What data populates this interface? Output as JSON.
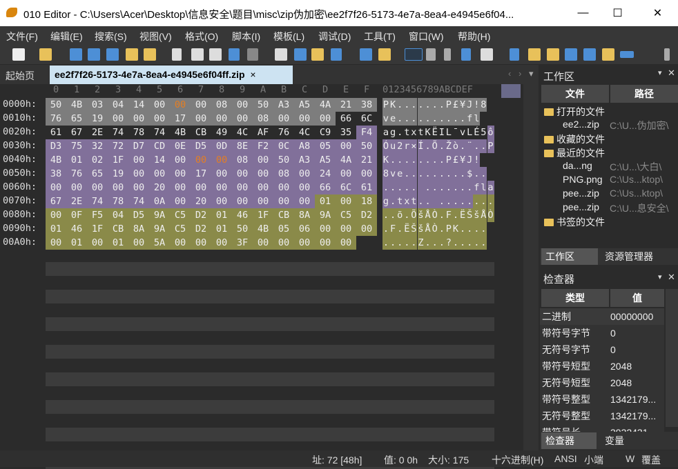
{
  "window": {
    "title": "010 Editor - C:\\Users\\Acer\\Desktop\\信息安全\\题目\\misc\\zip伪加密\\ee2f7f26-5173-4e7a-8ea4-e4945e6f04...",
    "minimize": "—",
    "maximize": "☐",
    "close": "✕"
  },
  "menu": [
    "文件(F)",
    "编辑(E)",
    "搜索(S)",
    "视图(V)",
    "格式(O)",
    "脚本(I)",
    "模板(L)",
    "调试(D)",
    "工具(T)",
    "窗口(W)",
    "帮助(H)"
  ],
  "tabs": {
    "start": "起始页",
    "file": "ee2f7f26-5173-4e7a-8ea4-e4945e6f04ff.zip",
    "close": "×"
  },
  "hex": {
    "col_headers": [
      "0",
      "1",
      "2",
      "3",
      "4",
      "5",
      "6",
      "7",
      "8",
      "9",
      "A",
      "B",
      "C",
      "D",
      "E",
      "F"
    ],
    "ascii_header": "0123456789ABCDEF",
    "rows": [
      {
        "offset": "0000h:",
        "bytes": [
          "50",
          "4B",
          "03",
          "04",
          "14",
          "00",
          "00",
          "00",
          "08",
          "00",
          "50",
          "A3",
          "A5",
          "4A",
          "21",
          "38"
        ],
        "ascii": "PK.......P£¥J!8"
      },
      {
        "offset": "0010h:",
        "bytes": [
          "76",
          "65",
          "19",
          "00",
          "00",
          "00",
          "17",
          "00",
          "00",
          "00",
          "08",
          "00",
          "00",
          "00",
          "66",
          "6C"
        ],
        "ascii": "ve..........fl"
      },
      {
        "offset": "0020h:",
        "bytes": [
          "61",
          "67",
          "2E",
          "74",
          "78",
          "74",
          "4B",
          "CB",
          "49",
          "4C",
          "AF",
          "76",
          "4C",
          "C9",
          "35",
          "F4"
        ],
        "ascii": "ag.txtKËIL¯vLÉ5ô"
      },
      {
        "offset": "0030h:",
        "bytes": [
          "D3",
          "75",
          "32",
          "72",
          "D7",
          "CD",
          "0E",
          "D5",
          "0D",
          "8E",
          "F2",
          "0C",
          "A8",
          "05",
          "00",
          "50"
        ],
        "ascii": "Óu2r×Í.Õ.Žò.¨..P"
      },
      {
        "offset": "0040h:",
        "bytes": [
          "4B",
          "01",
          "02",
          "1F",
          "00",
          "14",
          "00",
          "00",
          "00",
          "08",
          "00",
          "50",
          "A3",
          "A5",
          "4A",
          "21"
        ],
        "ascii": "K........P£¥J!"
      },
      {
        "offset": "0050h:",
        "bytes": [
          "38",
          "76",
          "65",
          "19",
          "00",
          "00",
          "00",
          "17",
          "00",
          "00",
          "00",
          "08",
          "00",
          "24",
          "00",
          "00"
        ],
        "ascii": "8ve.........$.."
      },
      {
        "offset": "0060h:",
        "bytes": [
          "00",
          "00",
          "00",
          "00",
          "00",
          "20",
          "00",
          "00",
          "00",
          "00",
          "00",
          "00",
          "00",
          "66",
          "6C",
          "61"
        ],
        "ascii": "..... .......fla"
      },
      {
        "offset": "0070h:",
        "bytes": [
          "67",
          "2E",
          "74",
          "78",
          "74",
          "0A",
          "00",
          "20",
          "00",
          "00",
          "00",
          "00",
          "00",
          "01",
          "00",
          "18"
        ],
        "ascii": "g.txt.. ........"
      },
      {
        "offset": "0080h:",
        "bytes": [
          "00",
          "0F",
          "F5",
          "04",
          "D5",
          "9A",
          "C5",
          "D2",
          "01",
          "46",
          "1F",
          "CB",
          "8A",
          "9A",
          "C5",
          "D2"
        ],
        "ascii": "..õ.ÕšÅÒ.F.ËŠšÅÒ"
      },
      {
        "offset": "0090h:",
        "bytes": [
          "01",
          "46",
          "1F",
          "CB",
          "8A",
          "9A",
          "C5",
          "D2",
          "01",
          "50",
          "4B",
          "05",
          "06",
          "00",
          "00",
          "00"
        ],
        "ascii": ".F.ËŠšÅÒ.PK...."
      },
      {
        "offset": "00A0h:",
        "bytes": [
          "00",
          "01",
          "00",
          "01",
          "00",
          "5A",
          "00",
          "00",
          "00",
          "3F",
          "00",
          "00",
          "00",
          "00",
          "00",
          ""
        ],
        "ascii": ".....Z...?....."
      }
    ]
  },
  "workspace": {
    "title": "工作区",
    "col_file": "文件",
    "col_path": "路径",
    "items": [
      {
        "type": "group",
        "label": "打开的文件"
      },
      {
        "type": "file",
        "name": "ee2...zip",
        "path": "C:\\U...伪加密\\"
      },
      {
        "type": "group",
        "label": "收藏的文件"
      },
      {
        "type": "group",
        "label": "最近的文件"
      },
      {
        "type": "file",
        "name": "da...ng",
        "path": "C:\\U...\\大白\\"
      },
      {
        "type": "file",
        "name": "PNG.png",
        "path": "C:\\Us...ktop\\"
      },
      {
        "type": "file",
        "name": "pee...zip",
        "path": "C:\\Us...ktop\\"
      },
      {
        "type": "file",
        "name": "pee...zip",
        "path": "C:\\U...息安全\\"
      },
      {
        "type": "group",
        "label": "书签的文件"
      }
    ],
    "tab_workspace": "工作区",
    "tab_explorer": "资源管理器"
  },
  "inspector": {
    "title": "检查器",
    "col_type": "类型",
    "col_value": "值",
    "rows": [
      {
        "type": "二进制",
        "value": "00000000"
      },
      {
        "type": "带符号字节",
        "value": "0"
      },
      {
        "type": "无符号字节",
        "value": "0"
      },
      {
        "type": "带符号短型",
        "value": "2048"
      },
      {
        "type": "无符号短型",
        "value": "2048"
      },
      {
        "type": "带符号整型",
        "value": "1342179..."
      },
      {
        "type": "无符号整型",
        "value": "1342179..."
      },
      {
        "type": "带符号长...",
        "value": "3932431..."
      }
    ],
    "tab_inspector": "检查器",
    "tab_vars": "变量"
  },
  "status": {
    "addr": "址: 72 [48h]",
    "value": "值: 0 0h",
    "size": "大小: 175",
    "mode": "十六进制(H)",
    "encoding": "ANSI",
    "endian": "小端",
    "w": "W",
    "overwrite": "覆盖"
  },
  "colors": {
    "gray": "#7d7d7d",
    "purple": "#81709a",
    "olive": "#8a8a49",
    "orange": "#e67e22",
    "tab_bg": "#cde3f2"
  }
}
